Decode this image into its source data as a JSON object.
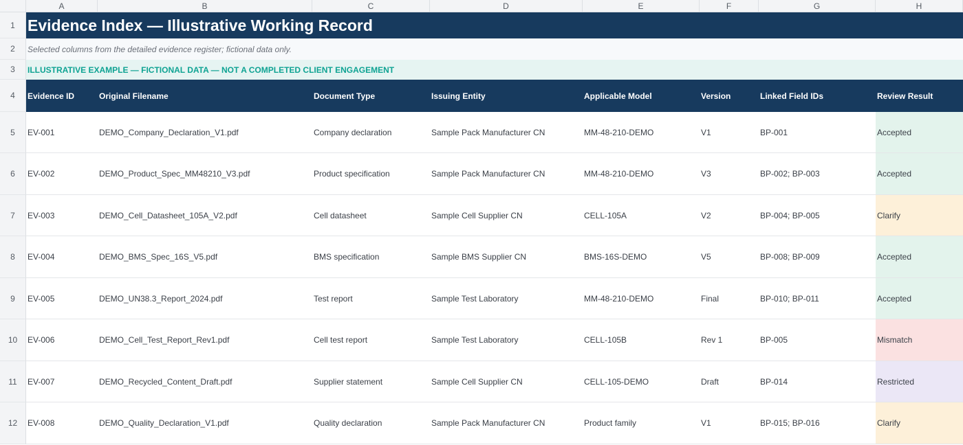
{
  "column_letters": [
    "A",
    "B",
    "C",
    "D",
    "E",
    "F",
    "G",
    "H"
  ],
  "row_numbers": [
    "1",
    "2",
    "3",
    "4",
    "5",
    "6",
    "7",
    "8",
    "9",
    "10",
    "11",
    "12"
  ],
  "title": "Evidence Index — Illustrative Working Record",
  "subtitle": "Selected columns from the detailed evidence register; fictional data only.",
  "banner": "ILLUSTRATIVE EXAMPLE — FICTIONAL DATA — NOT A COMPLETED CLIENT ENGAGEMENT",
  "headers": [
    "Evidence ID",
    "Original Filename",
    "Document Type",
    "Issuing Entity",
    "Applicable Model",
    "Version",
    "Linked Field IDs",
    "Review Result"
  ],
  "result_colors": {
    "Accepted": "#e3f3ec",
    "Clarify": "#fdf0d9",
    "Mismatch": "#fbe1e1",
    "Restricted": "#ebe7f6"
  },
  "rows": [
    [
      "EV-001",
      "DEMO_Company_Declaration_V1.pdf",
      "Company declaration",
      "Sample Pack Manufacturer CN",
      "MM-48-210-DEMO",
      "V1",
      "BP-001",
      "Accepted"
    ],
    [
      "EV-002",
      "DEMO_Product_Spec_MM48210_V3.pdf",
      "Product specification",
      "Sample Pack Manufacturer CN",
      "MM-48-210-DEMO",
      "V3",
      "BP-002; BP-003",
      "Accepted"
    ],
    [
      "EV-003",
      "DEMO_Cell_Datasheet_105A_V2.pdf",
      "Cell datasheet",
      "Sample Cell Supplier CN",
      "CELL-105A",
      "V2",
      "BP-004; BP-005",
      "Clarify"
    ],
    [
      "EV-004",
      "DEMO_BMS_Spec_16S_V5.pdf",
      "BMS specification",
      "Sample BMS Supplier CN",
      "BMS-16S-DEMO",
      "V5",
      "BP-008; BP-009",
      "Accepted"
    ],
    [
      "EV-005",
      "DEMO_UN38.3_Report_2024.pdf",
      "Test report",
      "Sample Test Laboratory",
      "MM-48-210-DEMO",
      "Final",
      "BP-010; BP-011",
      "Accepted"
    ],
    [
      "EV-006",
      "DEMO_Cell_Test_Report_Rev1.pdf",
      "Cell test report",
      "Sample Test Laboratory",
      "CELL-105B",
      "Rev 1",
      "BP-005",
      "Mismatch"
    ],
    [
      "EV-007",
      "DEMO_Recycled_Content_Draft.pdf",
      "Supplier statement",
      "Sample Cell Supplier CN",
      "CELL-105-DEMO",
      "Draft",
      "BP-014",
      "Restricted"
    ],
    [
      "EV-008",
      "DEMO_Quality_Declaration_V1.pdf",
      "Quality declaration",
      "Sample Pack Manufacturer CN",
      "Product family",
      "V1",
      "BP-015; BP-016",
      "Clarify"
    ]
  ]
}
